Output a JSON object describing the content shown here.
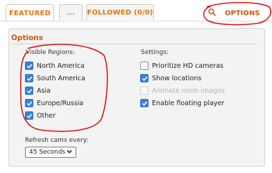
{
  "tabs": {
    "featured": "FEATURED",
    "more": "...",
    "followed": "FOLLOWED (0/0)"
  },
  "options_link": {
    "icon": "search-icon",
    "label": "OPTIONS"
  },
  "panel": {
    "title": "Options",
    "visible_regions": {
      "label": "Visible Regions:",
      "items": [
        {
          "label": "North America",
          "checked": true
        },
        {
          "label": "South America",
          "checked": true
        },
        {
          "label": "Asia",
          "checked": true
        },
        {
          "label": "Europe/Russia",
          "checked": true
        },
        {
          "label": "Other",
          "checked": true
        }
      ]
    },
    "settings": {
      "label": "Settings:",
      "items": [
        {
          "label": "Prioritize HD cameras",
          "checked": false,
          "disabled": false
        },
        {
          "label": "Show locations",
          "checked": true,
          "disabled": false
        },
        {
          "label": "Animate room images",
          "checked": false,
          "disabled": true
        },
        {
          "label": "Enable floating player",
          "checked": true,
          "disabled": false
        }
      ]
    },
    "refresh": {
      "label": "Refresh cams every:",
      "selected": "45 Seconds"
    }
  },
  "colors": {
    "accent": "#e8720c",
    "checkbox": "#3b82e0",
    "annotation": "#e01010"
  }
}
